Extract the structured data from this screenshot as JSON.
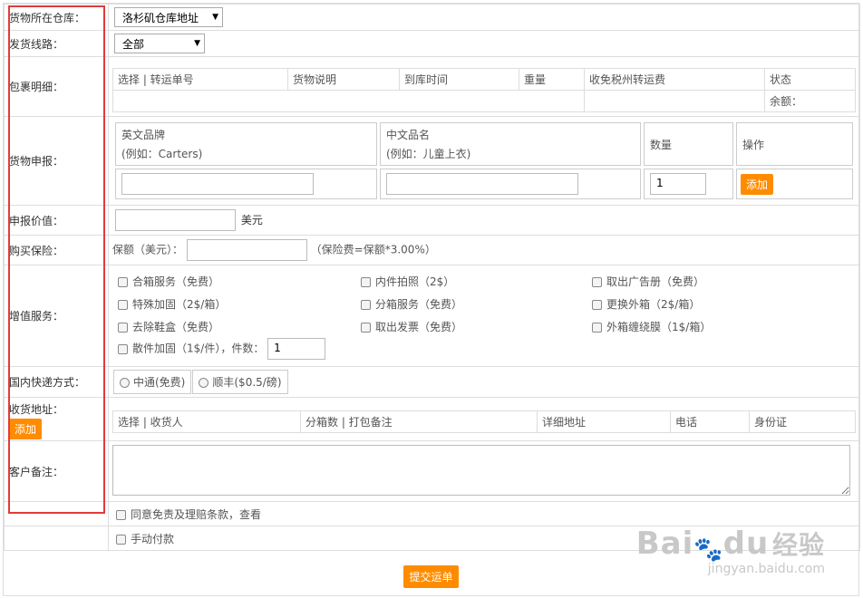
{
  "warehouse": {
    "label": "货物所在仓库：",
    "selected": "洛杉矶仓库地址"
  },
  "route": {
    "label": "发货线路：",
    "selected": "全部"
  },
  "parcel": {
    "label": "包裹明细：",
    "headers": [
      "选择 | 转运单号",
      "货物说明",
      "到库时间",
      "重量",
      "收免税州转运费",
      "状态"
    ],
    "balance_label": "余额："
  },
  "declaration": {
    "label": "货物申报：",
    "en_brand": "英文品牌",
    "en_brand_example": "(例如：Carters)",
    "cn_name": "中文品名",
    "cn_name_example": "(例如：儿童上衣)",
    "qty_label": "数量",
    "op_label": "操作",
    "qty_value": "1",
    "add_button": "添加"
  },
  "declared_value": {
    "label": "申报价值：",
    "unit": "美元"
  },
  "insurance": {
    "label": "购买保险：",
    "prefix": "保额（美元）：",
    "note": "（保险费=保额*3.00%）"
  },
  "value_added": {
    "label": "增值服务：",
    "items": [
      "合箱服务（免费）",
      "内件拍照（2$）",
      "取出广告册（免费）",
      "特殊加固（2$/箱）",
      "分箱服务（免费）",
      "更换外箱（2$/箱）",
      "去除鞋盒（免费）",
      "取出发票（免费）",
      "外箱缠绕膜（1$/箱）"
    ],
    "bulk_item": "散件加固（1$/件），件数：",
    "bulk_count": "1"
  },
  "domestic": {
    "label": "国内快递方式：",
    "options": [
      "中通(免费)",
      "顺丰($0.5/磅)"
    ]
  },
  "address": {
    "label": "收货地址：",
    "add_button": "添加",
    "headers": [
      "选择 | 收货人",
      "分箱数 | 打包备注",
      "详细地址",
      "电话",
      "身份证"
    ]
  },
  "remark": {
    "label": "客户备注："
  },
  "agree": {
    "text": "同意免责及理赔条款，查看"
  },
  "manual_pay": {
    "text": "手动付款"
  },
  "submit": {
    "label": "提交运单"
  },
  "watermark": {
    "brand": "Bai",
    "brand2": "du",
    "brand_cn": "经验",
    "url": "jingyan.baidu.com"
  }
}
